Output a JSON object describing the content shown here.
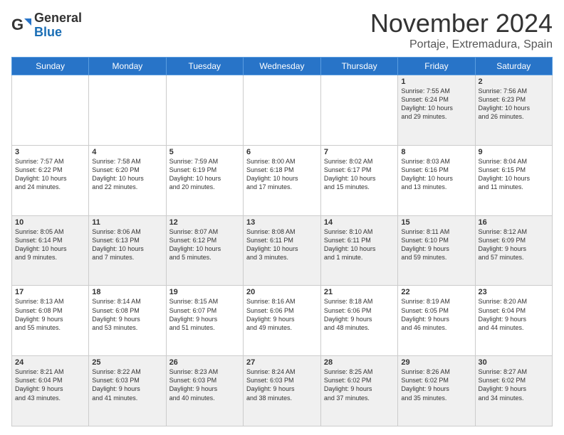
{
  "header": {
    "logo_general": "General",
    "logo_blue": "Blue",
    "month_title": "November 2024",
    "location": "Portaje, Extremadura, Spain"
  },
  "days_of_week": [
    "Sunday",
    "Monday",
    "Tuesday",
    "Wednesday",
    "Thursday",
    "Friday",
    "Saturday"
  ],
  "weeks": [
    [
      {
        "day": "",
        "info": ""
      },
      {
        "day": "",
        "info": ""
      },
      {
        "day": "",
        "info": ""
      },
      {
        "day": "",
        "info": ""
      },
      {
        "day": "",
        "info": ""
      },
      {
        "day": "1",
        "info": "Sunrise: 7:55 AM\nSunset: 6:24 PM\nDaylight: 10 hours\nand 29 minutes."
      },
      {
        "day": "2",
        "info": "Sunrise: 7:56 AM\nSunset: 6:23 PM\nDaylight: 10 hours\nand 26 minutes."
      }
    ],
    [
      {
        "day": "3",
        "info": "Sunrise: 7:57 AM\nSunset: 6:22 PM\nDaylight: 10 hours\nand 24 minutes."
      },
      {
        "day": "4",
        "info": "Sunrise: 7:58 AM\nSunset: 6:20 PM\nDaylight: 10 hours\nand 22 minutes."
      },
      {
        "day": "5",
        "info": "Sunrise: 7:59 AM\nSunset: 6:19 PM\nDaylight: 10 hours\nand 20 minutes."
      },
      {
        "day": "6",
        "info": "Sunrise: 8:00 AM\nSunset: 6:18 PM\nDaylight: 10 hours\nand 17 minutes."
      },
      {
        "day": "7",
        "info": "Sunrise: 8:02 AM\nSunset: 6:17 PM\nDaylight: 10 hours\nand 15 minutes."
      },
      {
        "day": "8",
        "info": "Sunrise: 8:03 AM\nSunset: 6:16 PM\nDaylight: 10 hours\nand 13 minutes."
      },
      {
        "day": "9",
        "info": "Sunrise: 8:04 AM\nSunset: 6:15 PM\nDaylight: 10 hours\nand 11 minutes."
      }
    ],
    [
      {
        "day": "10",
        "info": "Sunrise: 8:05 AM\nSunset: 6:14 PM\nDaylight: 10 hours\nand 9 minutes."
      },
      {
        "day": "11",
        "info": "Sunrise: 8:06 AM\nSunset: 6:13 PM\nDaylight: 10 hours\nand 7 minutes."
      },
      {
        "day": "12",
        "info": "Sunrise: 8:07 AM\nSunset: 6:12 PM\nDaylight: 10 hours\nand 5 minutes."
      },
      {
        "day": "13",
        "info": "Sunrise: 8:08 AM\nSunset: 6:11 PM\nDaylight: 10 hours\nand 3 minutes."
      },
      {
        "day": "14",
        "info": "Sunrise: 8:10 AM\nSunset: 6:11 PM\nDaylight: 10 hours\nand 1 minute."
      },
      {
        "day": "15",
        "info": "Sunrise: 8:11 AM\nSunset: 6:10 PM\nDaylight: 9 hours\nand 59 minutes."
      },
      {
        "day": "16",
        "info": "Sunrise: 8:12 AM\nSunset: 6:09 PM\nDaylight: 9 hours\nand 57 minutes."
      }
    ],
    [
      {
        "day": "17",
        "info": "Sunrise: 8:13 AM\nSunset: 6:08 PM\nDaylight: 9 hours\nand 55 minutes."
      },
      {
        "day": "18",
        "info": "Sunrise: 8:14 AM\nSunset: 6:08 PM\nDaylight: 9 hours\nand 53 minutes."
      },
      {
        "day": "19",
        "info": "Sunrise: 8:15 AM\nSunset: 6:07 PM\nDaylight: 9 hours\nand 51 minutes."
      },
      {
        "day": "20",
        "info": "Sunrise: 8:16 AM\nSunset: 6:06 PM\nDaylight: 9 hours\nand 49 minutes."
      },
      {
        "day": "21",
        "info": "Sunrise: 8:18 AM\nSunset: 6:06 PM\nDaylight: 9 hours\nand 48 minutes."
      },
      {
        "day": "22",
        "info": "Sunrise: 8:19 AM\nSunset: 6:05 PM\nDaylight: 9 hours\nand 46 minutes."
      },
      {
        "day": "23",
        "info": "Sunrise: 8:20 AM\nSunset: 6:04 PM\nDaylight: 9 hours\nand 44 minutes."
      }
    ],
    [
      {
        "day": "24",
        "info": "Sunrise: 8:21 AM\nSunset: 6:04 PM\nDaylight: 9 hours\nand 43 minutes."
      },
      {
        "day": "25",
        "info": "Sunrise: 8:22 AM\nSunset: 6:03 PM\nDaylight: 9 hours\nand 41 minutes."
      },
      {
        "day": "26",
        "info": "Sunrise: 8:23 AM\nSunset: 6:03 PM\nDaylight: 9 hours\nand 40 minutes."
      },
      {
        "day": "27",
        "info": "Sunrise: 8:24 AM\nSunset: 6:03 PM\nDaylight: 9 hours\nand 38 minutes."
      },
      {
        "day": "28",
        "info": "Sunrise: 8:25 AM\nSunset: 6:02 PM\nDaylight: 9 hours\nand 37 minutes."
      },
      {
        "day": "29",
        "info": "Sunrise: 8:26 AM\nSunset: 6:02 PM\nDaylight: 9 hours\nand 35 minutes."
      },
      {
        "day": "30",
        "info": "Sunrise: 8:27 AM\nSunset: 6:02 PM\nDaylight: 9 hours\nand 34 minutes."
      }
    ]
  ],
  "shaded_rows": [
    0,
    2,
    4
  ]
}
